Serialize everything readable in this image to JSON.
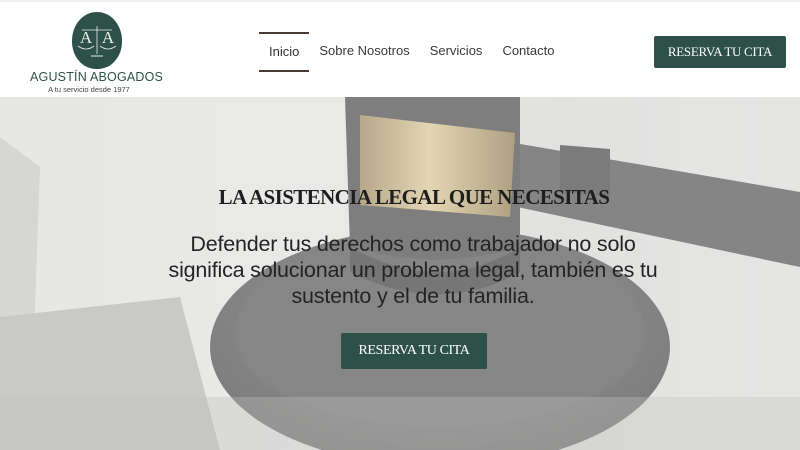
{
  "brand": {
    "monogram": "A A",
    "name": "AGUSTÍN ABOGADOS",
    "tagline": "A tu servicio desde 1977",
    "color": "#2d5149"
  },
  "nav": {
    "items": [
      {
        "label": "Inicio",
        "active": true
      },
      {
        "label": "Sobre Nosotros",
        "active": false
      },
      {
        "label": "Servicios",
        "active": false
      },
      {
        "label": "Contacto",
        "active": false
      }
    ]
  },
  "header_cta": {
    "label": "RESERVA TU CITA"
  },
  "hero": {
    "title": "LA ASISTENCIA LEGAL QUE NECESITAS",
    "text": "Defender tus derechos como trabajador no solo significa solucionar un problema legal, también es tu sustento y el de tu familia.",
    "cta_label": "RESERVA TU CITA",
    "image": "judge-gavel-photo"
  }
}
